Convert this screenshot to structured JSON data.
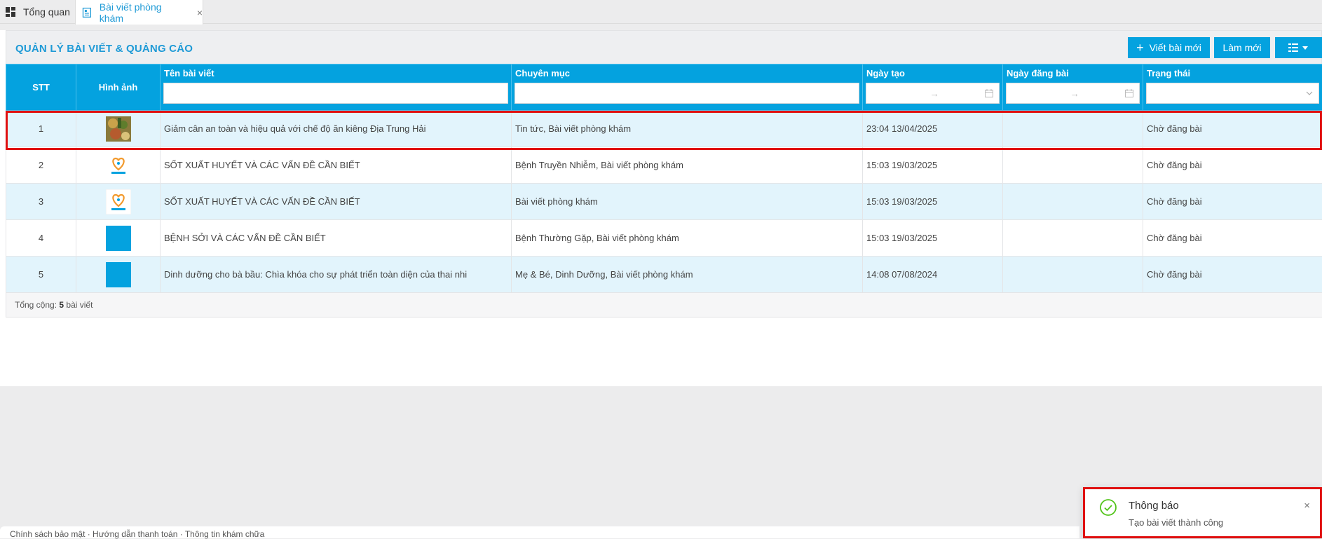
{
  "tabs": [
    {
      "label": "Tổng quan",
      "icon": "dashboard-icon"
    },
    {
      "label": "Bài viết phòng khám",
      "icon": "document-icon",
      "close": "×"
    }
  ],
  "header": {
    "title": "QUẢN LÝ BÀI VIẾT & QUẢNG CÁO",
    "new_label": "Viết bài mới",
    "refresh_label": "Làm mới",
    "columns_icon": "column-list-icon"
  },
  "table": {
    "columns": [
      "STT",
      "Hình ảnh",
      "Tên bài viết",
      "Chuyên mục",
      "Ngày tạo",
      "Ngày đăng bài",
      "Trạng thái"
    ],
    "date_range_separator": "→",
    "rows": [
      {
        "stt": "1",
        "image": "food-photo",
        "title": "Giảm cân an toàn và hiệu quả với chế độ ăn kiêng Địa Trung Hải",
        "category": "Tin tức, Bài viết phòng khám",
        "created": "23:04 13/04/2025",
        "published": "",
        "status": "Chờ đăng bài"
      },
      {
        "stt": "2",
        "image": "logo",
        "title": "SỐT XUẤT HUYẾT VÀ CÁC VẤN ĐỀ CẦN BIẾT",
        "category": "Bệnh Truyền Nhiễm, Bài viết phòng khám",
        "created": "15:03 19/03/2025",
        "published": "",
        "status": "Chờ đăng bài"
      },
      {
        "stt": "3",
        "image": "logo",
        "title": "SỐT XUẤT HUYẾT VÀ CÁC VẤN ĐỀ CẦN BIẾT",
        "category": "Bài viết phòng khám",
        "created": "15:03 19/03/2025",
        "published": "",
        "status": "Chờ đăng bài"
      },
      {
        "stt": "4",
        "image": "blue-placeholder",
        "title": "BỆNH SỞI VÀ CÁC VẤN ĐỀ CẦN BIẾT",
        "category": "Bệnh Thường Gặp, Bài viết phòng khám",
        "created": "15:03 19/03/2025",
        "published": "",
        "status": "Chờ đăng bài"
      },
      {
        "stt": "5",
        "image": "blue-placeholder",
        "title": "Dinh dưỡng cho bà bầu: Chìa khóa cho sự phát triển toàn diện của thai nhi",
        "category": "Mẹ & Bé, Dinh Dưỡng, Bài viết phòng khám",
        "created": "14:08 07/08/2024",
        "published": "",
        "status": "Chờ đăng bài"
      }
    ],
    "footer": {
      "prefix": "Tổng cộng: ",
      "count": "5",
      "suffix": " bài viết"
    }
  },
  "toast": {
    "title": "Thông báo",
    "message": "Tạo bài viết thành công",
    "icon": "check-circle-icon",
    "close": "×"
  },
  "bottom_text": "Chính sách bảo mật · Hướng dẫn thanh toán · Thông tin khám chữa",
  "colors": {
    "accent": "#04a2df",
    "status_pending": "#f2963c",
    "highlight": "#e01010"
  }
}
